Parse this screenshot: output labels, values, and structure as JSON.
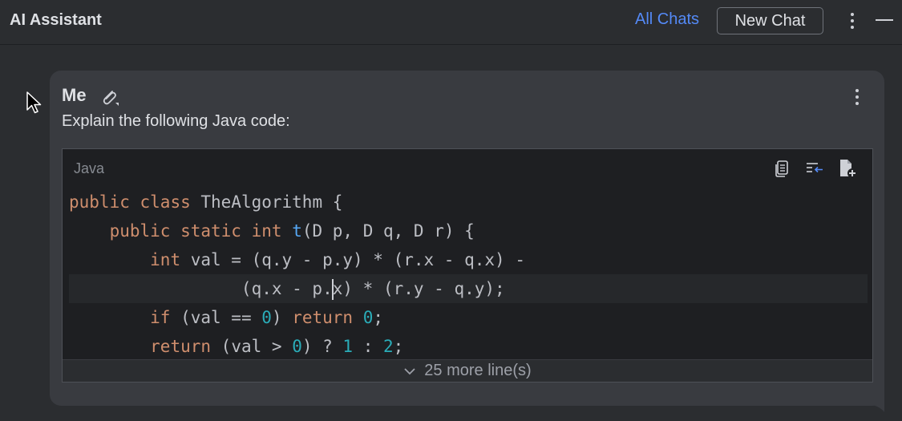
{
  "header": {
    "title": "AI Assistant",
    "all_chats_label": "All Chats",
    "new_chat_label": "New Chat"
  },
  "message": {
    "author": "Me",
    "text": "Explain the following Java code:",
    "code": {
      "language": "Java",
      "lines": [
        [
          {
            "t": "public ",
            "c": "kw"
          },
          {
            "t": "class ",
            "c": "kw"
          },
          {
            "t": "TheAlgorithm {",
            "c": ""
          }
        ],
        [
          {
            "t": "    ",
            "c": ""
          },
          {
            "t": "public ",
            "c": "kw"
          },
          {
            "t": "static ",
            "c": "kw"
          },
          {
            "t": "int ",
            "c": "kw"
          },
          {
            "t": "t",
            "c": "fn"
          },
          {
            "t": "(D p, D q, D r) {",
            "c": ""
          }
        ],
        [
          {
            "t": "        ",
            "c": ""
          },
          {
            "t": "int ",
            "c": "kw"
          },
          {
            "t": "val = (q.y - p.y) * (r.x - q.x) -",
            "c": ""
          }
        ],
        [
          {
            "t": "                 (q.x - p.",
            "c": ""
          },
          {
            "t": "",
            "c": "caret"
          },
          {
            "t": "x) * (r.y - q.y);",
            "c": ""
          }
        ],
        [
          {
            "t": "        ",
            "c": ""
          },
          {
            "t": "if ",
            "c": "kw"
          },
          {
            "t": "(val == ",
            "c": ""
          },
          {
            "t": "0",
            "c": "num"
          },
          {
            "t": ") ",
            "c": ""
          },
          {
            "t": "return ",
            "c": "kw"
          },
          {
            "t": "0",
            "c": "num"
          },
          {
            "t": ";",
            "c": ""
          }
        ],
        [
          {
            "t": "        ",
            "c": ""
          },
          {
            "t": "return ",
            "c": "kw"
          },
          {
            "t": "(val > ",
            "c": ""
          },
          {
            "t": "0",
            "c": "num"
          },
          {
            "t": ") ? ",
            "c": ""
          },
          {
            "t": "1",
            "c": "num"
          },
          {
            "t": " : ",
            "c": ""
          },
          {
            "t": "2",
            "c": "num"
          },
          {
            "t": ";",
            "c": ""
          }
        ]
      ],
      "current_line": 3,
      "more_lines_label": "25 more line(s)"
    }
  },
  "icons": {
    "header_menu": "kebab-icon",
    "minimize": "minimize-icon",
    "attach": "paperclip-icon",
    "message_menu": "kebab-icon",
    "copy": "copy-icon",
    "insert_at_caret": "insert-at-caret-icon",
    "new_file": "new-file-icon",
    "expand": "chevron-down-icon"
  },
  "colors": {
    "background": "#2b2d30",
    "bubble": "#393b40",
    "code_background": "#1e1f22",
    "link": "#548af7",
    "keyword": "#cf8e6d",
    "function": "#56a8f5",
    "number": "#2aacb8"
  }
}
